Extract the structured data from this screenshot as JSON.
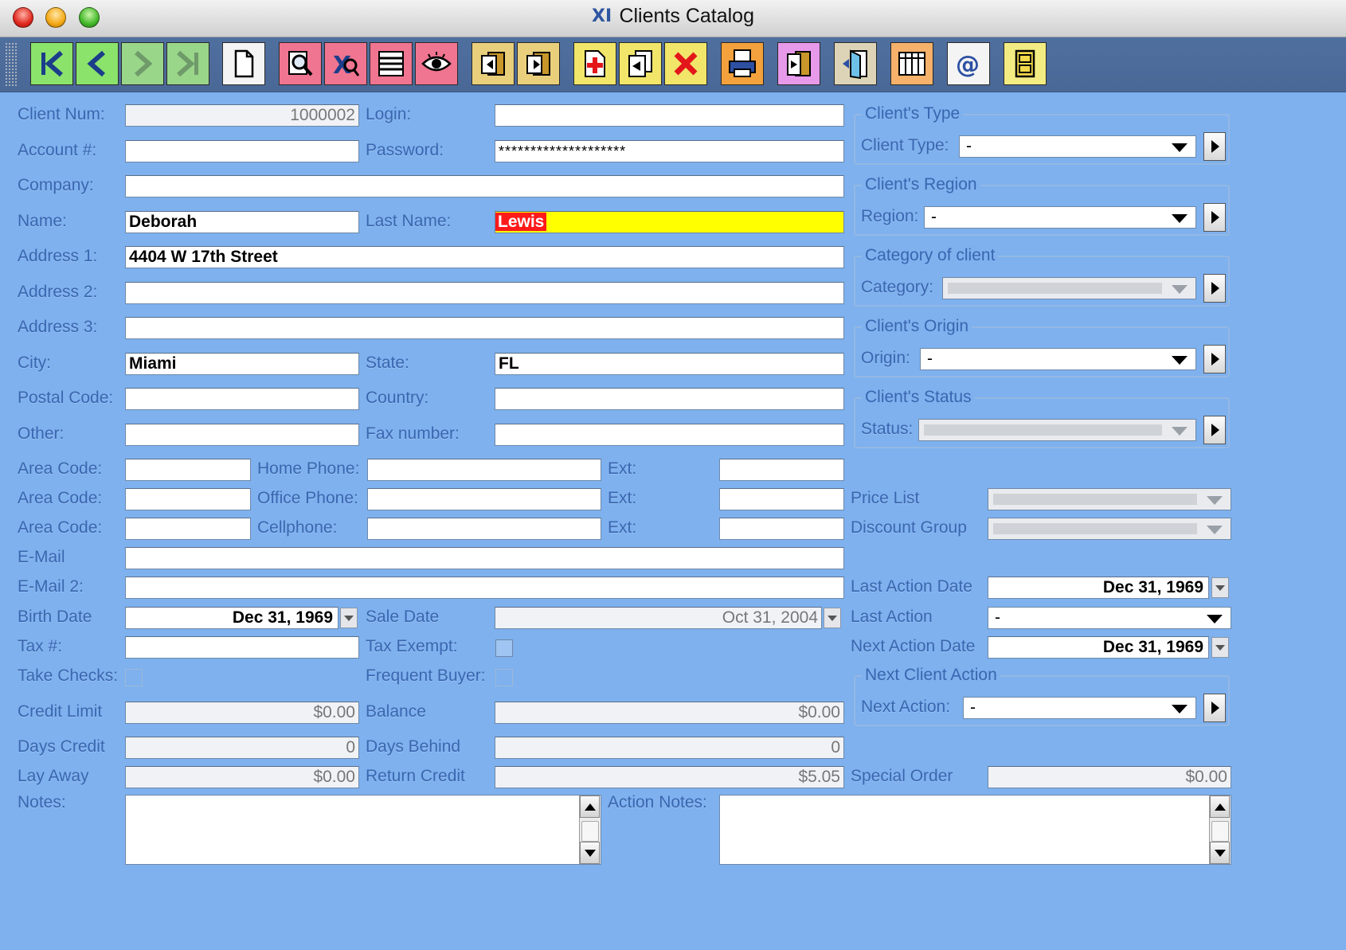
{
  "window": {
    "title": "Clients Catalog",
    "app_icon": "XI"
  },
  "toolbar": {
    "buttons": [
      {
        "name": "first-record-button",
        "icon": "first-record-icon"
      },
      {
        "name": "previous-record-button",
        "icon": "previous-record-icon"
      },
      {
        "name": "next-record-button",
        "icon": "next-record-icon"
      },
      {
        "name": "last-record-button",
        "icon": "last-record-icon"
      },
      {
        "name": "new-document-button",
        "icon": "document-icon"
      },
      {
        "name": "find-button",
        "icon": "magnifier-icon"
      },
      {
        "name": "query-button",
        "icon": "query-icon"
      },
      {
        "name": "list-button",
        "icon": "list-icon"
      },
      {
        "name": "view-button",
        "icon": "eye-icon"
      },
      {
        "name": "import-button",
        "icon": "import-icon"
      },
      {
        "name": "export-button",
        "icon": "export-icon"
      },
      {
        "name": "add-record-button",
        "icon": "add-icon"
      },
      {
        "name": "duplicate-button",
        "icon": "duplicate-icon"
      },
      {
        "name": "delete-button",
        "icon": "delete-icon"
      },
      {
        "name": "print-button",
        "icon": "print-icon"
      },
      {
        "name": "report-button",
        "icon": "report-icon"
      },
      {
        "name": "exit-button",
        "icon": "door-icon"
      },
      {
        "name": "grid-button",
        "icon": "grid-icon"
      },
      {
        "name": "email-button",
        "icon": "at-icon"
      },
      {
        "name": "cabinet-button",
        "icon": "cabinet-icon"
      }
    ]
  },
  "form": {
    "client_num": {
      "label": "Client Num:",
      "value": "1000002"
    },
    "login": {
      "label": "Login:",
      "value": ""
    },
    "account": {
      "label": "Account #:",
      "value": ""
    },
    "password": {
      "label": "Password:",
      "value": "********************"
    },
    "company": {
      "label": "Company:",
      "value": ""
    },
    "name": {
      "label": "Name:",
      "value": "Deborah"
    },
    "last_name": {
      "label": "Last Name:",
      "value": "Lewis"
    },
    "address1": {
      "label": "Address 1:",
      "value": "4404 W 17th Street"
    },
    "address2": {
      "label": "Address 2:",
      "value": ""
    },
    "address3": {
      "label": "Address 3:",
      "value": ""
    },
    "city": {
      "label": "City:",
      "value": "Miami"
    },
    "state": {
      "label": "State:",
      "value": "FL"
    },
    "postal_code": {
      "label": "Postal Code:",
      "value": ""
    },
    "country": {
      "label": "Country:",
      "value": ""
    },
    "other": {
      "label": "Other:",
      "value": ""
    },
    "fax": {
      "label": "Fax number:",
      "value": ""
    },
    "area_code_label": "Area Code:",
    "ext_label": "Ext:",
    "home_phone": {
      "label": "Home Phone:",
      "area": "",
      "number": "",
      "ext": ""
    },
    "office_phone": {
      "label": "Office Phone:",
      "area": "",
      "number": "",
      "ext": ""
    },
    "cellphone": {
      "label": "Cellphone:",
      "area": "",
      "number": "",
      "ext": ""
    },
    "email": {
      "label": "E-Mail",
      "value": ""
    },
    "email2": {
      "label": "E-Mail 2:",
      "value": ""
    },
    "birth_date": {
      "label": "Birth Date",
      "value": "Dec 31, 1969"
    },
    "sale_date": {
      "label": "Sale Date",
      "value": "Oct 31, 2004"
    },
    "tax_num": {
      "label": "Tax #:",
      "value": ""
    },
    "tax_exempt": {
      "label": "Tax Exempt:"
    },
    "take_checks": {
      "label": "Take Checks:"
    },
    "frequent_buyer": {
      "label": "Frequent Buyer:"
    },
    "credit_limit": {
      "label": "Credit Limit",
      "value": "$0.00"
    },
    "balance": {
      "label": "Balance",
      "value": "$0.00"
    },
    "days_credit": {
      "label": "Days Credit",
      "value": "0"
    },
    "days_behind": {
      "label": "Days Behind",
      "value": "0"
    },
    "lay_away": {
      "label": "Lay Away",
      "value": "$0.00"
    },
    "return_credit": {
      "label": "Return Credit",
      "value": "$5.05"
    },
    "special_order": {
      "label": "Special Order",
      "value": "$0.00"
    },
    "notes": {
      "label": "Notes:",
      "value": ""
    },
    "action_notes": {
      "label": "Action Notes:",
      "value": ""
    }
  },
  "side": {
    "client_type": {
      "group": "Client's Type",
      "label": "Client Type:",
      "value": "-"
    },
    "region": {
      "group": "Client's Region",
      "label": "Region:",
      "value": "-"
    },
    "category": {
      "group": "Category of client",
      "label": "Category:",
      "value": "-"
    },
    "origin": {
      "group": "Client's Origin",
      "label": "Origin:",
      "value": "-"
    },
    "status": {
      "group": "Client's Status",
      "label": "Status:",
      "value": "-"
    },
    "price_list": {
      "label": "Price List",
      "value": ""
    },
    "discount_group": {
      "label": "Discount Group",
      "value": ""
    },
    "last_action_date": {
      "label": "Last Action Date",
      "value": "Dec 31, 1969"
    },
    "last_action": {
      "label": "Last Action",
      "value": "-"
    },
    "next_action_date": {
      "label": "Next Action Date",
      "value": "Dec 31, 1969"
    },
    "next_client_action": {
      "group": "Next Client Action",
      "label": "Next Action:",
      "value": "-"
    }
  }
}
